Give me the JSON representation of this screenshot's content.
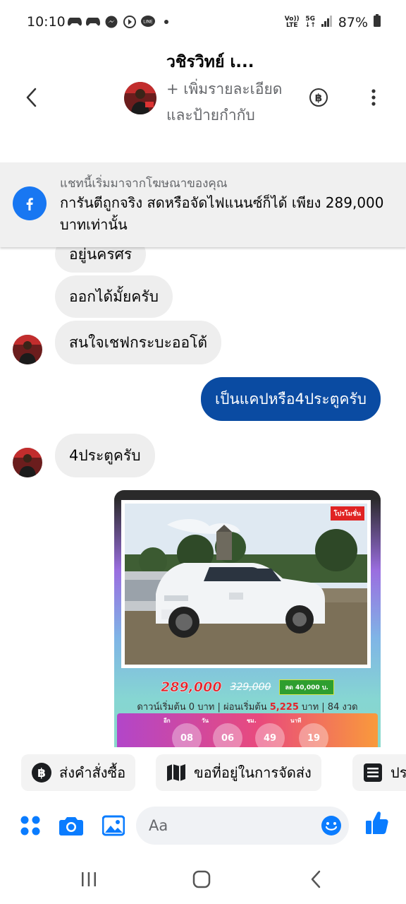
{
  "status_bar": {
    "time": "10:10",
    "net_top": "Vo))",
    "net_bottom": "LTE",
    "gen_top": "5G",
    "gen_bottom": "↓↑",
    "battery": "87%"
  },
  "header": {
    "title": "วชิรวิทย์ เ...",
    "subtitle": "+ เพิ่มรายละเอียดและป้ายกำกับ"
  },
  "ad_banner": {
    "label": "แชทนี้เริ่มมาจากโฆษณาของคุณ",
    "text": "การันตีถูกจริง สดหรือจัดไฟแนนซ์ก็ได้ เพียง 289,000 บาทเท่านั้น"
  },
  "messages": [
    {
      "direction": "incoming",
      "text": "อยู่นครศร"
    },
    {
      "direction": "incoming",
      "text": "ออกได้มั้ยครับ"
    },
    {
      "direction": "incoming",
      "text": "สนใจเชฟกระบะออโต้"
    },
    {
      "direction": "outgoing",
      "text": "เป็นแคปหรือ4ประตูครับ"
    },
    {
      "direction": "incoming",
      "text": "4ประตูครับ"
    }
  ],
  "product_card": {
    "promo_tag": "โปรโมชั่น",
    "price": "289,000",
    "old_price": "329,000",
    "discount": "ลด 40,000 บ.",
    "terms_prefix": "ดาวน์เริ่มต้น 0 บาท | ผ่อนเริ่มต้น",
    "monthly": "5,225",
    "terms_suffix": "บาท | 84 งวด",
    "countdown": [
      {
        "label": "อีก",
        "value": "08"
      },
      {
        "label": "วัน",
        "value": "06"
      },
      {
        "label": "ชม.",
        "value": "49"
      },
      {
        "label": "นาที",
        "value": "19"
      }
    ]
  },
  "quick_replies": [
    {
      "label": "ส่งคำสั่งซื้อ",
      "icon": "baht-icon"
    },
    {
      "label": "ขอที่อยู่ในการจัดส่ง",
      "icon": "map-icon"
    },
    {
      "label": "ประ",
      "icon": "list-icon"
    }
  ],
  "composer": {
    "placeholder": "Aa"
  },
  "colors": {
    "messenger_blue": "#0a4ba2",
    "accent_blue": "#1877f2",
    "bubble_gray": "#eeeeee",
    "price_red": "#e4232b"
  }
}
